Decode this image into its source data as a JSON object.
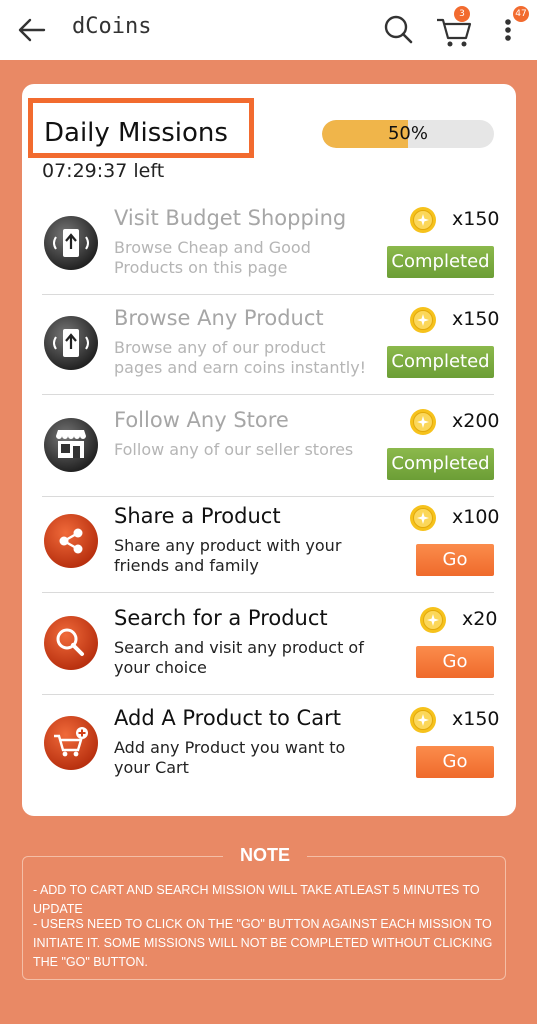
{
  "header": {
    "title": "dCoins",
    "cart_badge": "3",
    "menu_badge": "47"
  },
  "panel": {
    "title": "Daily Missions",
    "timer": "07:29:37 left",
    "progress_label": "50%",
    "progress_value": 50
  },
  "missions": [
    {
      "title": "Visit Budget Shopping",
      "desc": "Browse Cheap and Good Products on this page",
      "reward": "x150",
      "status": "Completed",
      "icon": "mobile-signal-icon"
    },
    {
      "title": "Browse Any Product",
      "desc": "Browse any of our product pages and earn coins instantly!",
      "reward": "x150",
      "status": "Completed",
      "icon": "mobile-signal-icon"
    },
    {
      "title": "Follow Any Store",
      "desc": "Follow any of our seller stores",
      "reward": "x200",
      "status": "Completed",
      "icon": "store-icon"
    },
    {
      "title": "Share a Product",
      "desc": "Share any product with your friends and family",
      "reward": "x100",
      "status": "Go",
      "icon": "share-icon"
    },
    {
      "title": "Search for a Product",
      "desc": "Search and visit any product of your choice",
      "reward": "x20",
      "status": "Go",
      "icon": "search-icon"
    },
    {
      "title": "Add A Product to Cart",
      "desc": "Add any Product you want to your Cart",
      "reward": "x150",
      "status": "Go",
      "icon": "add-to-cart-icon"
    }
  ],
  "note": {
    "title": "NOTE",
    "lines": [
      "- ADD TO CART AND SEARCH MISSION WILL TAKE ATLEAST 5 MINUTES TO UPDATE",
      "- USERS NEED TO CLICK ON THE \"GO\" BUTTON AGAINST EACH MISSION TO INITIATE IT. SOME MISSIONS WILL NOT BE COMPLETED WITHOUT CLICKING THE \"GO\" BUTTON."
    ]
  },
  "colors": {
    "background": "#e98965",
    "accent": "#f26b2f",
    "completed": "#7aab3e",
    "progress": "#f0b54a"
  }
}
